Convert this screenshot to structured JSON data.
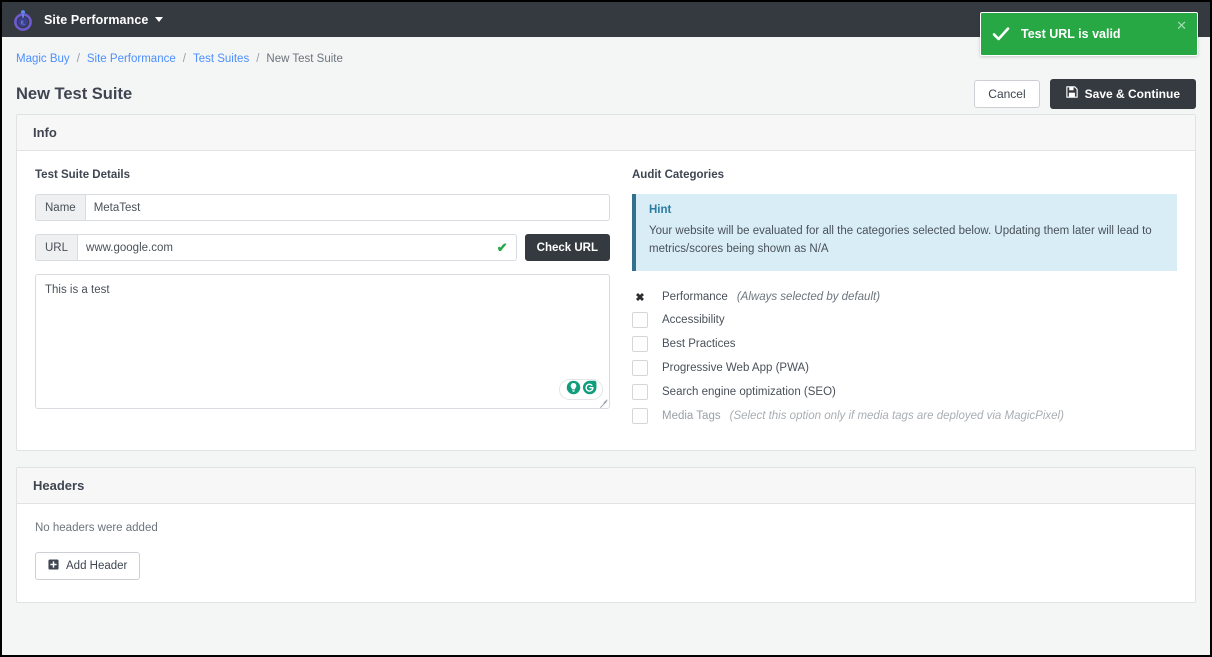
{
  "topbar": {
    "logo_icon": "power-circle-logo-icon",
    "app_title": "Site Performance",
    "caret_icon": "chevron-down-icon"
  },
  "toast": {
    "icon": "check-icon",
    "message": "Test URL is valid",
    "close_icon": "close-icon",
    "background_color": "#28a745"
  },
  "breadcrumb": {
    "items": [
      {
        "label": "Magic Buy",
        "current": false
      },
      {
        "label": "Site Performance",
        "current": false
      },
      {
        "label": "Test Suites",
        "current": false
      },
      {
        "label": "New Test Suite",
        "current": true
      }
    ],
    "separator": "/",
    "link_color": "#4d90fe"
  },
  "header": {
    "title": "New Test Suite",
    "cancel_label": "Cancel",
    "save_label": "Save & Continue",
    "save_icon": "floppy-disk-icon"
  },
  "info_card": {
    "title": "Info",
    "details": {
      "section_label": "Test Suite Details",
      "name_prefix": "Name",
      "name_value": "MetaTest",
      "name_placeholder": "Name",
      "url_prefix": "URL",
      "url_value": "www.google.com",
      "url_placeholder": "URL",
      "url_valid_icon": "check-icon",
      "check_url_label": "Check URL",
      "description_value": "This is a test",
      "description_placeholder": "Description",
      "grammarly_icons": [
        "lightbulb-icon",
        "grammarly-g-icon"
      ],
      "resize_handle": "resize-grip-icon"
    },
    "audit": {
      "section_label": "Audit Categories",
      "hint_title": "Hint",
      "hint_text": "Your website will be evaluated for all the categories selected below. Updating them later will lead to metrics/scores being shown as N/A",
      "hint_bg_color": "#d9edf7",
      "hint_accent_color": "#31708f",
      "categories": [
        {
          "label": "Performance",
          "note": "(Always selected by default)",
          "state": "locked-checked",
          "icon": "x-mark-icon",
          "muted": false
        },
        {
          "label": "Accessibility",
          "note": "",
          "state": "unchecked",
          "icon": "checkbox-icon",
          "muted": false
        },
        {
          "label": "Best Practices",
          "note": "",
          "state": "unchecked",
          "icon": "checkbox-icon",
          "muted": false
        },
        {
          "label": "Progressive Web App (PWA)",
          "note": "",
          "state": "unchecked",
          "icon": "checkbox-icon",
          "muted": false
        },
        {
          "label": "Search engine optimization (SEO)",
          "note": "",
          "state": "unchecked",
          "icon": "checkbox-icon",
          "muted": false
        },
        {
          "label": "Media Tags",
          "note": "(Select this option only if media tags are deployed via MagicPixel)",
          "state": "unchecked",
          "icon": "checkbox-icon",
          "muted": true
        }
      ]
    }
  },
  "headers_card": {
    "title": "Headers",
    "empty_text": "No headers were added",
    "add_label": "Add Header",
    "add_icon": "plus-square-icon"
  }
}
